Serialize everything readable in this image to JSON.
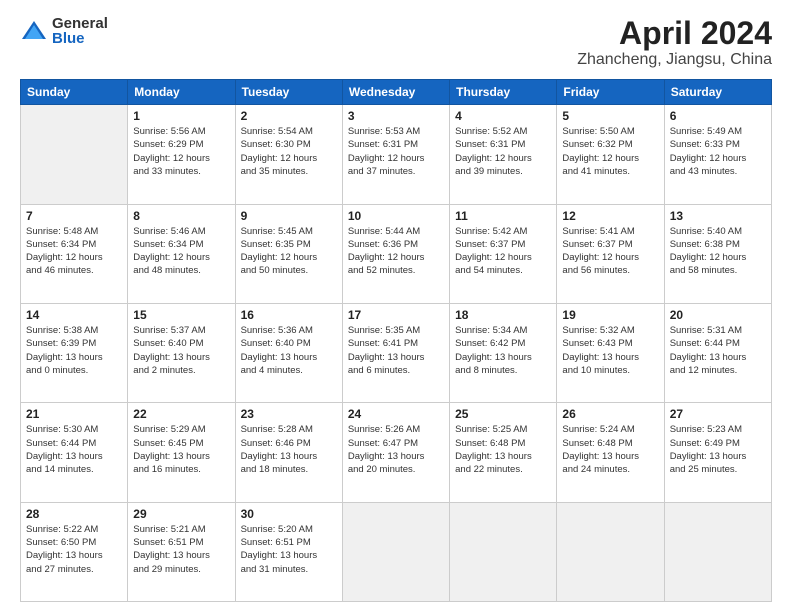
{
  "header": {
    "logo_general": "General",
    "logo_blue": "Blue",
    "title": "April 2024",
    "location": "Zhancheng, Jiangsu, China"
  },
  "weekdays": [
    "Sunday",
    "Monday",
    "Tuesday",
    "Wednesday",
    "Thursday",
    "Friday",
    "Saturday"
  ],
  "weeks": [
    [
      {
        "day": "",
        "info": ""
      },
      {
        "day": "1",
        "info": "Sunrise: 5:56 AM\nSunset: 6:29 PM\nDaylight: 12 hours\nand 33 minutes."
      },
      {
        "day": "2",
        "info": "Sunrise: 5:54 AM\nSunset: 6:30 PM\nDaylight: 12 hours\nand 35 minutes."
      },
      {
        "day": "3",
        "info": "Sunrise: 5:53 AM\nSunset: 6:31 PM\nDaylight: 12 hours\nand 37 minutes."
      },
      {
        "day": "4",
        "info": "Sunrise: 5:52 AM\nSunset: 6:31 PM\nDaylight: 12 hours\nand 39 minutes."
      },
      {
        "day": "5",
        "info": "Sunrise: 5:50 AM\nSunset: 6:32 PM\nDaylight: 12 hours\nand 41 minutes."
      },
      {
        "day": "6",
        "info": "Sunrise: 5:49 AM\nSunset: 6:33 PM\nDaylight: 12 hours\nand 43 minutes."
      }
    ],
    [
      {
        "day": "7",
        "info": "Sunrise: 5:48 AM\nSunset: 6:34 PM\nDaylight: 12 hours\nand 46 minutes."
      },
      {
        "day": "8",
        "info": "Sunrise: 5:46 AM\nSunset: 6:34 PM\nDaylight: 12 hours\nand 48 minutes."
      },
      {
        "day": "9",
        "info": "Sunrise: 5:45 AM\nSunset: 6:35 PM\nDaylight: 12 hours\nand 50 minutes."
      },
      {
        "day": "10",
        "info": "Sunrise: 5:44 AM\nSunset: 6:36 PM\nDaylight: 12 hours\nand 52 minutes."
      },
      {
        "day": "11",
        "info": "Sunrise: 5:42 AM\nSunset: 6:37 PM\nDaylight: 12 hours\nand 54 minutes."
      },
      {
        "day": "12",
        "info": "Sunrise: 5:41 AM\nSunset: 6:37 PM\nDaylight: 12 hours\nand 56 minutes."
      },
      {
        "day": "13",
        "info": "Sunrise: 5:40 AM\nSunset: 6:38 PM\nDaylight: 12 hours\nand 58 minutes."
      }
    ],
    [
      {
        "day": "14",
        "info": "Sunrise: 5:38 AM\nSunset: 6:39 PM\nDaylight: 13 hours\nand 0 minutes."
      },
      {
        "day": "15",
        "info": "Sunrise: 5:37 AM\nSunset: 6:40 PM\nDaylight: 13 hours\nand 2 minutes."
      },
      {
        "day": "16",
        "info": "Sunrise: 5:36 AM\nSunset: 6:40 PM\nDaylight: 13 hours\nand 4 minutes."
      },
      {
        "day": "17",
        "info": "Sunrise: 5:35 AM\nSunset: 6:41 PM\nDaylight: 13 hours\nand 6 minutes."
      },
      {
        "day": "18",
        "info": "Sunrise: 5:34 AM\nSunset: 6:42 PM\nDaylight: 13 hours\nand 8 minutes."
      },
      {
        "day": "19",
        "info": "Sunrise: 5:32 AM\nSunset: 6:43 PM\nDaylight: 13 hours\nand 10 minutes."
      },
      {
        "day": "20",
        "info": "Sunrise: 5:31 AM\nSunset: 6:44 PM\nDaylight: 13 hours\nand 12 minutes."
      }
    ],
    [
      {
        "day": "21",
        "info": "Sunrise: 5:30 AM\nSunset: 6:44 PM\nDaylight: 13 hours\nand 14 minutes."
      },
      {
        "day": "22",
        "info": "Sunrise: 5:29 AM\nSunset: 6:45 PM\nDaylight: 13 hours\nand 16 minutes."
      },
      {
        "day": "23",
        "info": "Sunrise: 5:28 AM\nSunset: 6:46 PM\nDaylight: 13 hours\nand 18 minutes."
      },
      {
        "day": "24",
        "info": "Sunrise: 5:26 AM\nSunset: 6:47 PM\nDaylight: 13 hours\nand 20 minutes."
      },
      {
        "day": "25",
        "info": "Sunrise: 5:25 AM\nSunset: 6:48 PM\nDaylight: 13 hours\nand 22 minutes."
      },
      {
        "day": "26",
        "info": "Sunrise: 5:24 AM\nSunset: 6:48 PM\nDaylight: 13 hours\nand 24 minutes."
      },
      {
        "day": "27",
        "info": "Sunrise: 5:23 AM\nSunset: 6:49 PM\nDaylight: 13 hours\nand 25 minutes."
      }
    ],
    [
      {
        "day": "28",
        "info": "Sunrise: 5:22 AM\nSunset: 6:50 PM\nDaylight: 13 hours\nand 27 minutes."
      },
      {
        "day": "29",
        "info": "Sunrise: 5:21 AM\nSunset: 6:51 PM\nDaylight: 13 hours\nand 29 minutes."
      },
      {
        "day": "30",
        "info": "Sunrise: 5:20 AM\nSunset: 6:51 PM\nDaylight: 13 hours\nand 31 minutes."
      },
      {
        "day": "",
        "info": ""
      },
      {
        "day": "",
        "info": ""
      },
      {
        "day": "",
        "info": ""
      },
      {
        "day": "",
        "info": ""
      }
    ]
  ]
}
